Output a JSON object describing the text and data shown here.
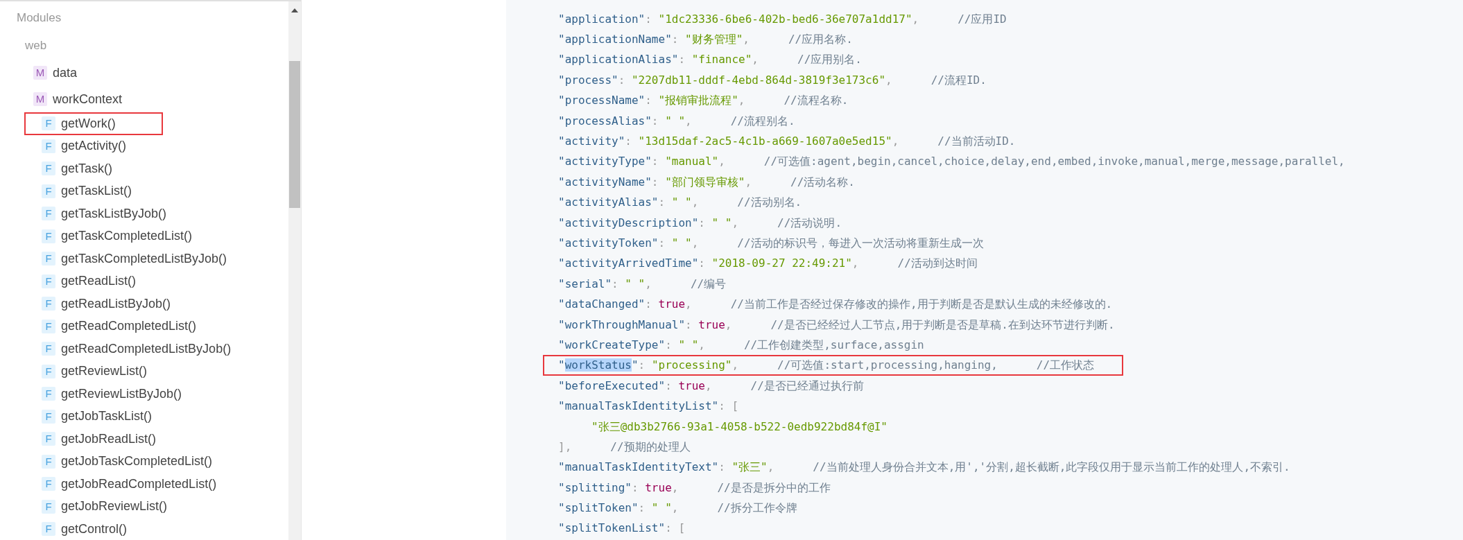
{
  "sidebar": {
    "tree": [
      {
        "label": "Modules",
        "children": [
          {
            "label": "web",
            "children": [
              {
                "label": "data",
                "kind": "module",
                "badge": "M",
                "boxed": false
              },
              {
                "label": "workContext",
                "kind": "module",
                "badge": "M",
                "boxed": false
              },
              {
                "label": "getWork()",
                "kind": "function",
                "badge": "F",
                "boxed": true
              },
              {
                "label": "getActivity()",
                "kind": "function",
                "badge": "F",
                "boxed": false
              },
              {
                "label": "getTask()",
                "kind": "function",
                "badge": "F",
                "boxed": false
              },
              {
                "label": "getTaskList()",
                "kind": "function",
                "badge": "F",
                "boxed": false
              },
              {
                "label": "getTaskListByJob()",
                "kind": "function",
                "badge": "F",
                "boxed": false
              },
              {
                "label": "getTaskCompletedList()",
                "kind": "function",
                "badge": "F",
                "boxed": false
              },
              {
                "label": "getTaskCompletedListByJob()",
                "kind": "function",
                "badge": "F",
                "boxed": false
              },
              {
                "label": "getReadList()",
                "kind": "function",
                "badge": "F",
                "boxed": false
              },
              {
                "label": "getReadListByJob()",
                "kind": "function",
                "badge": "F",
                "boxed": false
              },
              {
                "label": "getReadCompletedList()",
                "kind": "function",
                "badge": "F",
                "boxed": false
              },
              {
                "label": "getReadCompletedListByJob()",
                "kind": "function",
                "badge": "F",
                "boxed": false
              },
              {
                "label": "getReviewList()",
                "kind": "function",
                "badge": "F",
                "boxed": false
              },
              {
                "label": "getReviewListByJob()",
                "kind": "function",
                "badge": "F",
                "boxed": false
              },
              {
                "label": "getJobTaskList()",
                "kind": "function",
                "badge": "F",
                "boxed": false
              },
              {
                "label": "getJobReadList()",
                "kind": "function",
                "badge": "F",
                "boxed": false
              },
              {
                "label": "getJobTaskCompletedList()",
                "kind": "function",
                "badge": "F",
                "boxed": false
              },
              {
                "label": "getJobReadCompletedList()",
                "kind": "function",
                "badge": "F",
                "boxed": false
              },
              {
                "label": "getJobReviewList()",
                "kind": "function",
                "badge": "F",
                "boxed": false
              },
              {
                "label": "getControl()",
                "kind": "function",
                "badge": "F",
                "boxed": false
              }
            ]
          }
        ]
      }
    ]
  },
  "code": {
    "lines": [
      {
        "boxed": false,
        "tokens": [
          {
            "text": "\"application\"",
            "kind": "key"
          },
          {
            "text": ": ",
            "kind": "punct"
          },
          {
            "text": "\"1dc23336-6be6-402b-bed6-36e707a1dd17\"",
            "kind": "string"
          },
          {
            "text": ",",
            "kind": "punct"
          },
          {
            "text": "//应用ID",
            "kind": "comment"
          }
        ]
      },
      {
        "boxed": false,
        "tokens": [
          {
            "text": "\"applicationName\"",
            "kind": "key"
          },
          {
            "text": ": ",
            "kind": "punct"
          },
          {
            "text": "\"财务管理\"",
            "kind": "string"
          },
          {
            "text": ",",
            "kind": "punct"
          },
          {
            "text": "//应用名称.",
            "kind": "comment"
          }
        ]
      },
      {
        "boxed": false,
        "tokens": [
          {
            "text": "\"applicationAlias\"",
            "kind": "key"
          },
          {
            "text": ": ",
            "kind": "punct"
          },
          {
            "text": "\"finance\"",
            "kind": "string"
          },
          {
            "text": ",",
            "kind": "punct"
          },
          {
            "text": "//应用别名.",
            "kind": "comment"
          }
        ]
      },
      {
        "boxed": false,
        "tokens": [
          {
            "text": "\"process\"",
            "kind": "key"
          },
          {
            "text": ": ",
            "kind": "punct"
          },
          {
            "text": "\"2207db11-dddf-4ebd-864d-3819f3e173c6\"",
            "kind": "string"
          },
          {
            "text": ",",
            "kind": "punct"
          },
          {
            "text": "//流程ID.",
            "kind": "comment"
          }
        ]
      },
      {
        "boxed": false,
        "tokens": [
          {
            "text": "\"processName\"",
            "kind": "key"
          },
          {
            "text": ": ",
            "kind": "punct"
          },
          {
            "text": "\"报销审批流程\"",
            "kind": "string"
          },
          {
            "text": ",",
            "kind": "punct"
          },
          {
            "text": "//流程名称.",
            "kind": "comment"
          }
        ]
      },
      {
        "boxed": false,
        "tokens": [
          {
            "text": "\"processAlias\"",
            "kind": "key"
          },
          {
            "text": ": ",
            "kind": "punct"
          },
          {
            "text": "\" \"",
            "kind": "string"
          },
          {
            "text": ",",
            "kind": "punct"
          },
          {
            "text": "//流程别名.",
            "kind": "comment"
          }
        ]
      },
      {
        "boxed": false,
        "tokens": [
          {
            "text": "\"activity\"",
            "kind": "key"
          },
          {
            "text": ": ",
            "kind": "punct"
          },
          {
            "text": "\"13d15daf-2ac5-4c1b-a669-1607a0e5ed15\"",
            "kind": "string"
          },
          {
            "text": ",",
            "kind": "punct"
          },
          {
            "text": "//当前活动ID.",
            "kind": "comment"
          }
        ]
      },
      {
        "boxed": false,
        "tokens": [
          {
            "text": "\"activityType\"",
            "kind": "key"
          },
          {
            "text": ": ",
            "kind": "punct"
          },
          {
            "text": "\"manual\"",
            "kind": "string"
          },
          {
            "text": ",",
            "kind": "punct"
          },
          {
            "text": "//可选值:agent,begin,cancel,choice,delay,end,embed,invoke,manual,merge,message,parallel,",
            "kind": "comment"
          }
        ]
      },
      {
        "boxed": false,
        "tokens": [
          {
            "text": "\"activityName\"",
            "kind": "key"
          },
          {
            "text": ": ",
            "kind": "punct"
          },
          {
            "text": "\"部门领导审核\"",
            "kind": "string"
          },
          {
            "text": ",",
            "kind": "punct"
          },
          {
            "text": "//活动名称.",
            "kind": "comment"
          }
        ]
      },
      {
        "boxed": false,
        "tokens": [
          {
            "text": "\"activityAlias\"",
            "kind": "key"
          },
          {
            "text": ": ",
            "kind": "punct"
          },
          {
            "text": "\" \"",
            "kind": "string"
          },
          {
            "text": ",",
            "kind": "punct"
          },
          {
            "text": "//活动别名.",
            "kind": "comment"
          }
        ]
      },
      {
        "boxed": false,
        "tokens": [
          {
            "text": "\"activityDescription\"",
            "kind": "key"
          },
          {
            "text": ": ",
            "kind": "punct"
          },
          {
            "text": "\" \"",
            "kind": "string"
          },
          {
            "text": ",",
            "kind": "punct"
          },
          {
            "text": "//活动说明.",
            "kind": "comment"
          }
        ]
      },
      {
        "boxed": false,
        "tokens": [
          {
            "text": "\"activityToken\"",
            "kind": "key"
          },
          {
            "text": ": ",
            "kind": "punct"
          },
          {
            "text": "\" \"",
            "kind": "string"
          },
          {
            "text": ",",
            "kind": "punct"
          },
          {
            "text": "//活动的标识号，每进入一次活动将重新生成一次",
            "kind": "comment"
          }
        ]
      },
      {
        "boxed": false,
        "tokens": [
          {
            "text": "\"activityArrivedTime\"",
            "kind": "key"
          },
          {
            "text": ": ",
            "kind": "punct"
          },
          {
            "text": "\"2018-09-27 22:49:21\"",
            "kind": "string"
          },
          {
            "text": ",",
            "kind": "punct"
          },
          {
            "text": "//活动到达时间",
            "kind": "comment"
          }
        ]
      },
      {
        "boxed": false,
        "tokens": [
          {
            "text": "\"serial\"",
            "kind": "key"
          },
          {
            "text": ": ",
            "kind": "punct"
          },
          {
            "text": "\" \"",
            "kind": "string"
          },
          {
            "text": ",",
            "kind": "punct"
          },
          {
            "text": "//编号",
            "kind": "comment"
          }
        ]
      },
      {
        "boxed": false,
        "tokens": [
          {
            "text": "\"dataChanged\"",
            "kind": "key"
          },
          {
            "text": ": ",
            "kind": "punct"
          },
          {
            "text": "true",
            "kind": "keyword"
          },
          {
            "text": ",",
            "kind": "punct"
          },
          {
            "text": "//当前工作是否经过保存修改的操作,用于判断是否是默认生成的未经修改的.",
            "kind": "comment"
          }
        ]
      },
      {
        "boxed": false,
        "tokens": [
          {
            "text": "\"workThroughManual\"",
            "kind": "key"
          },
          {
            "text": ": ",
            "kind": "punct"
          },
          {
            "text": "true",
            "kind": "keyword"
          },
          {
            "text": ",",
            "kind": "punct"
          },
          {
            "text": "//是否已经经过人工节点,用于判断是否是草稿.在到达环节进行判断.",
            "kind": "comment"
          }
        ]
      },
      {
        "boxed": false,
        "tokens": [
          {
            "text": "\"workCreateType\"",
            "kind": "key"
          },
          {
            "text": ": ",
            "kind": "punct"
          },
          {
            "text": "\" \"",
            "kind": "string"
          },
          {
            "text": ",",
            "kind": "punct"
          },
          {
            "text": "//工作创建类型,surface,assgin",
            "kind": "comment"
          }
        ]
      },
      {
        "boxed": true,
        "tokens": [
          {
            "text": "\"",
            "kind": "key"
          },
          {
            "text": "workStatus",
            "kind": "key",
            "highlighted": true
          },
          {
            "text": "\"",
            "kind": "key"
          },
          {
            "text": ": ",
            "kind": "punct"
          },
          {
            "text": "\"processing\"",
            "kind": "string"
          },
          {
            "text": ",",
            "kind": "punct"
          },
          {
            "text": "//可选值:start,processing,hanging,",
            "kind": "comment"
          },
          {
            "text": "//工作状态",
            "kind": "comment"
          }
        ]
      },
      {
        "boxed": false,
        "tokens": [
          {
            "text": "\"beforeExecuted\"",
            "kind": "key"
          },
          {
            "text": ": ",
            "kind": "punct"
          },
          {
            "text": "true",
            "kind": "keyword"
          },
          {
            "text": ",",
            "kind": "punct"
          },
          {
            "text": "//是否已经通过执行前",
            "kind": "comment"
          }
        ]
      },
      {
        "boxed": false,
        "tokens": [
          {
            "text": "\"manualTaskIdentityList\"",
            "kind": "key"
          },
          {
            "text": ": ",
            "kind": "punct"
          },
          {
            "text": "[",
            "kind": "punct"
          }
        ],
        "children": [
          {
            "boxed": false,
            "tokens": [
              {
                "text": "\"张三@db3b2766-93a1-4058-b522-0edb922bd84f@I\"",
                "kind": "string"
              }
            ]
          }
        ]
      },
      {
        "boxed": false,
        "tokens": [
          {
            "text": "],",
            "kind": "punct"
          },
          {
            "text": "//预期的处理人",
            "kind": "comment"
          }
        ]
      },
      {
        "boxed": false,
        "tokens": [
          {
            "text": "\"manualTaskIdentityText\"",
            "kind": "key"
          },
          {
            "text": ": ",
            "kind": "punct"
          },
          {
            "text": "\"张三\"",
            "kind": "string"
          },
          {
            "text": ",",
            "kind": "punct"
          },
          {
            "text": "//当前处理人身份合并文本,用','分割,超长截断,此字段仅用于显示当前工作的处理人,不索引.",
            "kind": "comment"
          }
        ]
      },
      {
        "boxed": false,
        "tokens": [
          {
            "text": "\"splitting\"",
            "kind": "key"
          },
          {
            "text": ": ",
            "kind": "punct"
          },
          {
            "text": "true",
            "kind": "keyword"
          },
          {
            "text": ",",
            "kind": "punct"
          },
          {
            "text": "//是否是拆分中的工作",
            "kind": "comment"
          }
        ]
      },
      {
        "boxed": false,
        "tokens": [
          {
            "text": "\"splitToken\"",
            "kind": "key"
          },
          {
            "text": ": ",
            "kind": "punct"
          },
          {
            "text": "\" \"",
            "kind": "string"
          },
          {
            "text": ",",
            "kind": "punct"
          },
          {
            "text": "//拆分工作令牌",
            "kind": "comment"
          }
        ]
      },
      {
        "boxed": false,
        "tokens": [
          {
            "text": "\"splitTokenList\"",
            "kind": "key"
          },
          {
            "text": ": ",
            "kind": "punct"
          },
          {
            "text": "[",
            "kind": "punct"
          }
        ]
      }
    ]
  }
}
